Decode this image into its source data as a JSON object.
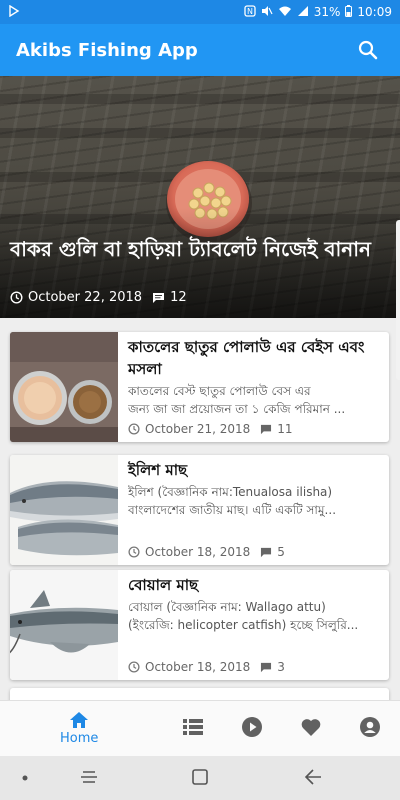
{
  "status_bar": {
    "battery": "31%",
    "time": "10:09"
  },
  "app_bar": {
    "title": "Akibs Fishing App",
    "search_icon": "search-icon"
  },
  "featured": {
    "title": "বাকর গুলি বা হাড়িয়া ট্যাবলেট নিজেই বানান",
    "date": "October 22, 2018",
    "comments": "12"
  },
  "posts": [
    {
      "title": "কাতলের ছাতুর পোলাউ এর বেইস এবং মসলা",
      "excerpt_lines": [
        "কাতলের বেস্ট ছাতুর পোলাউ বেস এর",
        "জন্য জা জা প্রয়োজন তা ১ কেজি পরিমান ..."
      ],
      "date": "October 21, 2018",
      "comments": "11"
    },
    {
      "title": "ইলিশ মাছ",
      "excerpt_lines": [
        "ইলিশ (বৈজ্ঞানিক নাম:Tenualosa ilisha)",
        "বাংলাদেশের জাতীয় মাছ। এটি একটি সামু..."
      ],
      "date": "October 18, 2018",
      "comments": "5"
    },
    {
      "title": "বোয়াল মাছ",
      "excerpt_lines": [
        "বোয়াল (বৈজ্ঞানিক নাম: Wallago attu)",
        "(ইংরেজি: helicopter catfish) হচ্ছে সিলুরি..."
      ],
      "date": "October 18, 2018",
      "comments": "3"
    }
  ],
  "bottom_nav": {
    "home_label": "Home",
    "active_color": "#1e88e5",
    "icons": [
      "home-icon",
      "list-icon",
      "play-icon",
      "heart-icon",
      "account-icon"
    ]
  },
  "colors": {
    "primary": "#2196f3",
    "status_bar": "#1e88e5"
  }
}
